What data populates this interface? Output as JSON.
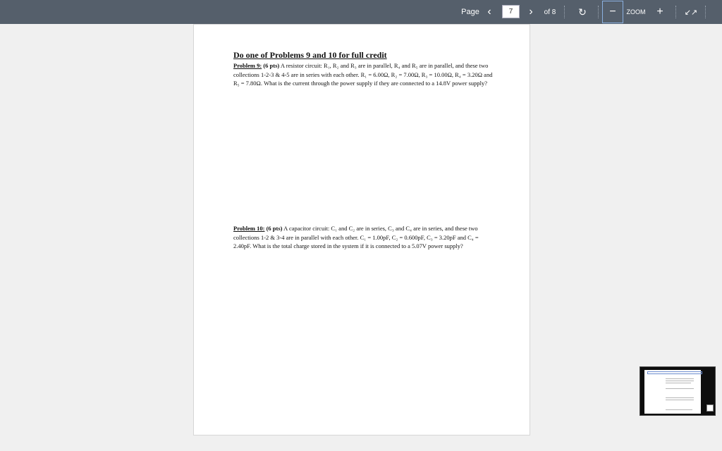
{
  "toolbar": {
    "page_label": "Page",
    "prev_icon": "‹",
    "current_page": "7",
    "next_icon": "›",
    "of_label": "of 8",
    "rotate_icon": "↻",
    "zoom_out_icon": "−",
    "zoom_label": "ZOOM",
    "zoom_in_icon": "+",
    "collapse_icon": "↙↗",
    "colors": {
      "bar": "#555f6b",
      "text": "#ffffff",
      "highlight": "#8ab0e0"
    }
  },
  "document": {
    "heading": "Do one of Problems 9 and 10 for full credit",
    "problem9": {
      "title": "Problem 9:",
      "pts": "(6 pts)",
      "text": " A resistor circuit: R₁, R₂ and R₃ are in parallel, R₄ and R₅ are in parallel, and these two collections 1-2-3 & 4-5 are in series with each other.  R₁ = 6.00Ω, R₂ = 7.00Ω, R₃ = 10.00Ω, R₄ = 3.20Ω and R₅ = 7.80Ω.  What is the current through the power supply if they are connected to a 14.8V power supply?"
    },
    "problem10": {
      "title": "Problem 10:",
      "pts": "(6 pts)",
      "text": " A capacitor circuit: C₁ and C₂ are in series, C₃ and C₄ are in series, and these two collections 1-2 & 3-4 are in parallel with each other.  C₁ = 1.00pF, C₂ = 0.600pF, C₃ = 3.20pF and C₄ = 2.40pF.  What is the total charge stored in the system if it is connected to a 5.07V power supply?"
    }
  }
}
